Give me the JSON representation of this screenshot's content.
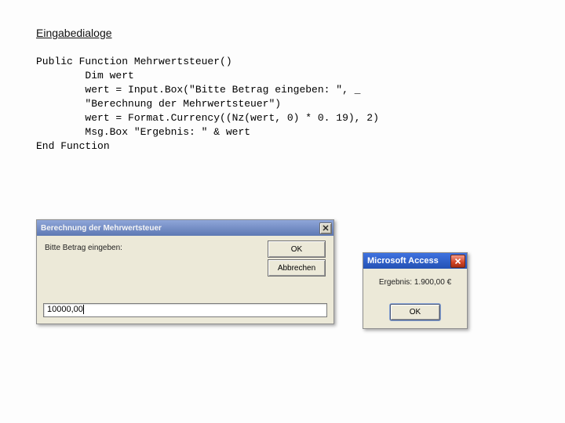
{
  "heading": "Eingabedialoge",
  "code": {
    "line1": "Public Function Mehrwertsteuer()",
    "line2": "        Dim wert",
    "line3": "        wert = Input.Box(\"Bitte Betrag eingeben: \", _",
    "line4": "        \"Berechnung der Mehrwertsteuer\")",
    "line5": "        wert = Format.Currency((Nz(wert, 0) * 0. 19), 2)",
    "line6": "        Msg.Box \"Ergebnis: \" & wert",
    "line7": "End Function"
  },
  "inputbox": {
    "title": "Berechnung der Mehrwertsteuer",
    "prompt": "Bitte Betrag eingeben:",
    "ok": "OK",
    "cancel": "Abbrechen",
    "value": "10000,00"
  },
  "msgbox": {
    "title": "Microsoft Access",
    "text": "Ergebnis: 1.900,00 €",
    "ok": "OK"
  }
}
